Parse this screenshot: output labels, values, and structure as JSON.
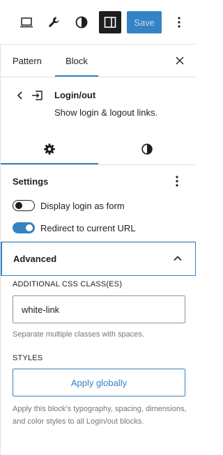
{
  "toolbar": {
    "save_label": "Save",
    "icons": [
      "desktop-icon",
      "wrench-icon",
      "half-circle-icon",
      "sidebar-toggle-icon",
      "more-vertical-icon"
    ],
    "colors": {
      "accent": "#3582c4",
      "save_text": "#c9dcee",
      "dark": "#1e1e1e"
    }
  },
  "tabs": {
    "pattern_label": "Pattern",
    "block_label": "Block",
    "active": "Block"
  },
  "block_card": {
    "title": "Login/out",
    "description": "Show login & logout links."
  },
  "inspector_tabs": {
    "active": "settings",
    "icons": [
      "gear-icon",
      "half-circle-icon"
    ]
  },
  "settings": {
    "title": "Settings",
    "toggles": [
      {
        "label": "Display login as form",
        "checked": false
      },
      {
        "label": "Redirect to current URL",
        "checked": true
      }
    ]
  },
  "advanced": {
    "title": "Advanced",
    "expanded": true,
    "css_class_label": "ADDITIONAL CSS CLASS(ES)",
    "css_class_value": "white-link",
    "css_class_help": "Separate multiple classes with spaces.",
    "styles_label": "STYLES",
    "apply_button_label": "Apply globally",
    "apply_help": "Apply this block’s typography, spacing, dimensions, and color styles to all Login/out blocks."
  }
}
